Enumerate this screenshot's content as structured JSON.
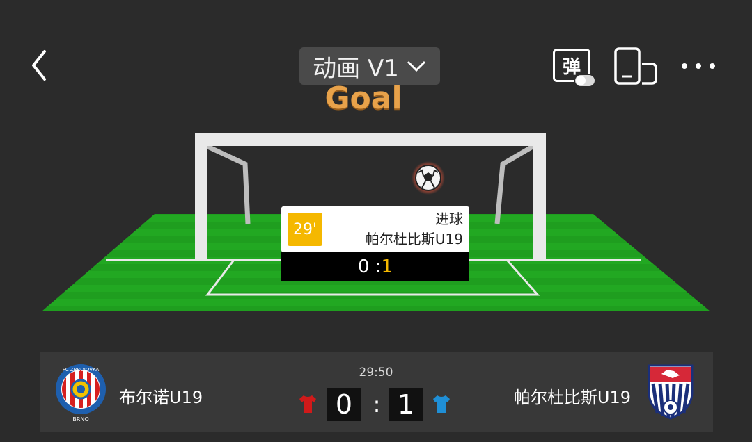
{
  "top_bar": {
    "mode_label": "动画 V1",
    "danmaku_label": "弹"
  },
  "animation": {
    "headline": "Goal",
    "event": {
      "minute": "29'",
      "type": "进球",
      "team": "帕尔杜比斯U19",
      "score_home": "0",
      "score_separator": " :",
      "score_away": "1"
    }
  },
  "scoreboard": {
    "match_clock": "29:50",
    "home": {
      "name": "布尔诺U19",
      "score": "0",
      "shirt_color": "#d01a1a",
      "crest_text_top": "FC ZBROJOVKA",
      "crest_text_bottom": "BRNO"
    },
    "away": {
      "name": "帕尔杜比斯U19",
      "score": "1",
      "shirt_color": "#1f8fd6"
    },
    "separator": ":"
  },
  "colors": {
    "background": "#2b2b2b",
    "pitch_green": "#1fa31f",
    "headline_orange": "#e8a24a",
    "minute_badge": "#f5b800",
    "highlight_score": "#f5b800"
  },
  "icons": [
    "back-chevron-icon",
    "dropdown-chevron-icon",
    "danmaku-toggle-icon",
    "rotate-screen-icon",
    "more-dots-icon",
    "soccer-ball-icon",
    "jersey-icon"
  ]
}
